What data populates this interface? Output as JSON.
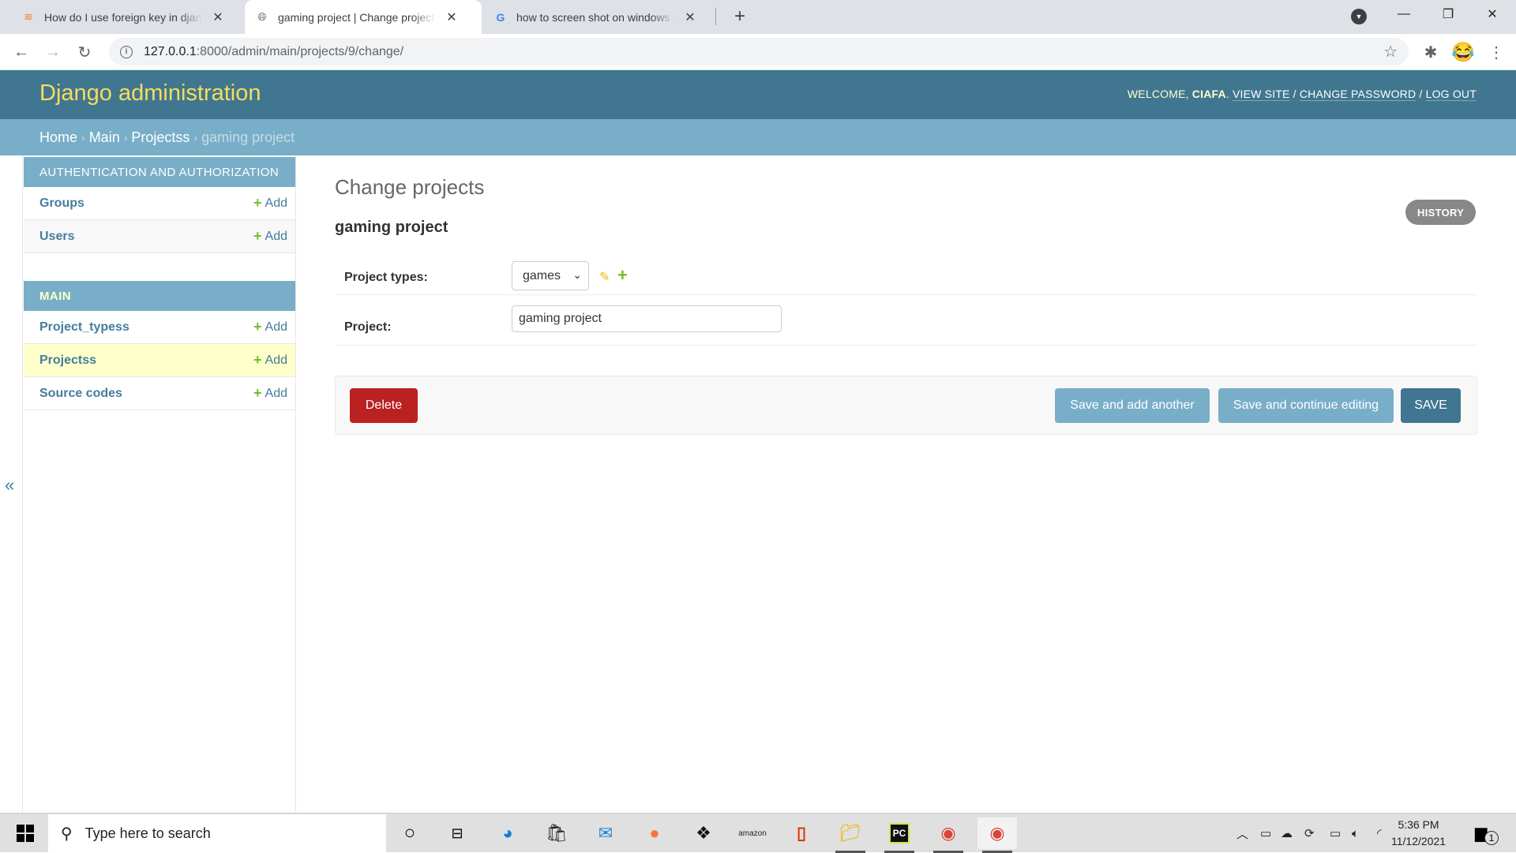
{
  "browser": {
    "tabs": [
      {
        "title": "How do I use foreign key in djang",
        "favicon": "stackoverflow-icon",
        "active": false
      },
      {
        "title": "gaming project | Change projects",
        "favicon": "globe-icon",
        "active": true
      },
      {
        "title": "how to screen shot on windows -",
        "favicon": "google-icon",
        "active": false
      }
    ],
    "url_host": "127.0.0.1",
    "url_rest": ":8000/admin/main/projects/9/change/"
  },
  "header": {
    "brand": "Django administration",
    "welcome": "Welcome,",
    "username": "ciafa",
    "view_site": "View site",
    "change_password": "Change password",
    "log_out": "Log out",
    "slash": "/"
  },
  "breadcrumbs": {
    "home": "Home",
    "app": "Main",
    "model": "Projectss",
    "current": "gaming project",
    "sep": "›"
  },
  "sidebar": {
    "collapse": "«",
    "modules": [
      {
        "caption": "Authentication and Authorization",
        "items": [
          {
            "name": "Groups",
            "add": "Add"
          },
          {
            "name": "Users",
            "add": "Add"
          }
        ]
      },
      {
        "caption": "Main",
        "items": [
          {
            "name": "Project_typess",
            "add": "Add"
          },
          {
            "name": "Projectss",
            "add": "Add",
            "selected": true
          },
          {
            "name": "Source codes",
            "add": "Add"
          }
        ]
      }
    ]
  },
  "content": {
    "title": "Change projects",
    "object_title": "gaming project",
    "history": "HISTORY",
    "fields": {
      "project_types": {
        "label": "Project types:",
        "value": "games"
      },
      "project": {
        "label": "Project:",
        "value": "gaming project"
      }
    },
    "buttons": {
      "delete": "Delete",
      "save_add_another": "Save and add another",
      "save_continue": "Save and continue editing",
      "save": "SAVE"
    }
  },
  "taskbar": {
    "search_placeholder": "Type here to search",
    "time": "5:36 PM",
    "date": "11/12/2021",
    "notification_count": "1"
  }
}
